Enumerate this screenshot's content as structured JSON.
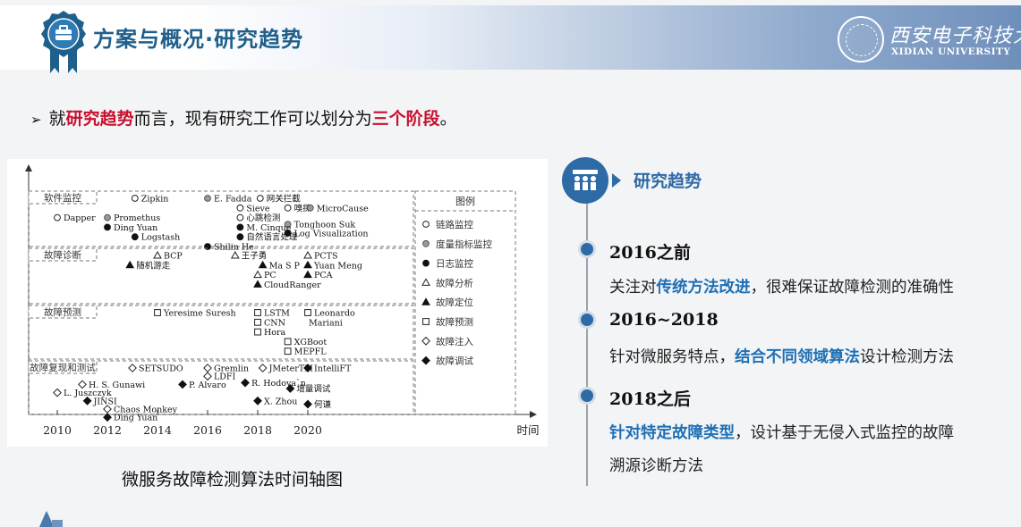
{
  "header": {
    "title": "方案与概况·研究趋势",
    "university_cn": "西安电子科技大学",
    "university_en": "XIDIAN UNIVERSITY",
    "badge_icon": "briefcase-icon"
  },
  "intro": {
    "bullet": "➢",
    "p1": "就",
    "p2": "研究趋势",
    "p3": "而言，现有研究工作可以划分为",
    "p4": "三个阶段",
    "p5": "。"
  },
  "chart_data": {
    "type": "timeline",
    "xlabel": "时间",
    "x_ticks": [
      "2010",
      "2012",
      "2014",
      "2016",
      "2018",
      "2020"
    ],
    "legend_title": "图例",
    "legend": [
      {
        "marker": "circle-open",
        "label": "链路监控"
      },
      {
        "marker": "circle-gray",
        "label": "度量指标监控"
      },
      {
        "marker": "circle-filled",
        "label": "日志监控"
      },
      {
        "marker": "triangle-open",
        "label": "故障分析"
      },
      {
        "marker": "triangle-filled",
        "label": "故障定位"
      },
      {
        "marker": "square-open",
        "label": "故障预测"
      },
      {
        "marker": "diamond-open",
        "label": "故障注入"
      },
      {
        "marker": "diamond-filled",
        "label": "故障调试"
      }
    ],
    "lanes": [
      {
        "label": "软件监控",
        "items": [
          {
            "m": "circle-open",
            "t": "Zipkin",
            "year": 2013.1,
            "row": 0
          },
          {
            "m": "circle-gray",
            "t": "E. Fadda",
            "year": 2016,
            "row": 0
          },
          {
            "m": "circle-open",
            "t": "网关拦截",
            "year": 2018.1,
            "row": 0
          },
          {
            "m": "circle-open",
            "t": "嗅探",
            "year": 2019.2,
            "row": 1
          },
          {
            "m": "circle-gray",
            "t": "MicroCause",
            "year": 2020.1,
            "row": 1
          },
          {
            "m": "circle-open",
            "t": "Dapper",
            "year": 2010,
            "row": 2
          },
          {
            "m": "circle-gray",
            "t": "Promethus",
            "year": 2012,
            "row": 2
          },
          {
            "m": "circle-open",
            "t": "Sieve",
            "year": 2017.3,
            "row": 1
          },
          {
            "m": "circle-open",
            "t": "心跳检测",
            "year": 2017.3,
            "row": 2
          },
          {
            "m": "circle-gray",
            "t": "Tonghoon Suk",
            "year": 2019.2,
            "row": 2.7
          },
          {
            "m": "circle-filled",
            "t": "Ding Yuan",
            "year": 2012,
            "row": 3
          },
          {
            "m": "circle-filled",
            "t": "M. Cinque",
            "year": 2017.3,
            "row": 3
          },
          {
            "m": "circle-filled",
            "t": "Log Visualization",
            "year": 2019.2,
            "row": 3.6
          },
          {
            "m": "circle-filled",
            "t": "Logstash",
            "year": 2013.1,
            "row": 4
          },
          {
            "m": "circle-filled",
            "t": "自然语言处理",
            "year": 2017.3,
            "row": 4
          },
          {
            "m": "circle-filled",
            "t": "Shilin He",
            "year": 2016,
            "row": 5
          }
        ]
      },
      {
        "label": "故障诊断",
        "items": [
          {
            "m": "triangle-open",
            "t": "BCP",
            "year": 2014,
            "row": 0
          },
          {
            "m": "triangle-open",
            "t": "王子勇",
            "year": 2017.1,
            "row": 0
          },
          {
            "m": "triangle-open",
            "t": "PCTS",
            "year": 2020,
            "row": 0
          },
          {
            "m": "triangle-filled",
            "t": "Ma S P",
            "year": 2018.2,
            "row": 1
          },
          {
            "m": "triangle-filled",
            "t": "Yuan Meng",
            "year": 2020,
            "row": 1
          },
          {
            "m": "triangle-filled",
            "t": "随机游走",
            "year": 2012.9,
            "row": 1
          },
          {
            "m": "triangle-open",
            "t": "PC",
            "year": 2018,
            "row": 2
          },
          {
            "m": "triangle-filled",
            "t": "PCA",
            "year": 2020,
            "row": 2
          },
          {
            "m": "triangle-filled",
            "t": "CloudRanger",
            "year": 2018,
            "row": 3
          }
        ]
      },
      {
        "label": "故障预测",
        "items": [
          {
            "m": "square-open",
            "t": "Yeresime Suresh",
            "year": 2014,
            "row": 0
          },
          {
            "m": "square-open",
            "t": "LSTM",
            "year": 2018,
            "row": 0
          },
          {
            "m": "square-open",
            "t": "Leonardo",
            "year": 2020,
            "row": 0
          },
          {
            "m": "square-open",
            "t": "CNN",
            "year": 2018,
            "row": 1
          },
          {
            "m": "square-open",
            "t": "Mariani",
            "year": 2020,
            "row": 1,
            "nomark": true
          },
          {
            "m": "square-open",
            "t": "Hora",
            "year": 2018,
            "row": 2
          },
          {
            "m": "square-open",
            "t": "XGBoot",
            "year": 2019.2,
            "row": 3
          },
          {
            "m": "square-open",
            "t": "MEPFL",
            "year": 2019.2,
            "row": 4
          }
        ]
      },
      {
        "label": "故障复现和测试",
        "items": [
          {
            "m": "diamond-open",
            "t": "SETSUDO",
            "year": 2013,
            "row": 0
          },
          {
            "m": "diamond-open",
            "t": "Gremlin",
            "year": 2016,
            "row": 0
          },
          {
            "m": "diamond-open",
            "t": "JMeterTM",
            "year": 2018.2,
            "row": 0
          },
          {
            "m": "diamond-filled",
            "t": "IntelliFT",
            "year": 2020,
            "row": 0
          },
          {
            "m": "diamond-open",
            "t": "LDFI",
            "year": 2016,
            "row": 1
          },
          {
            "m": "diamond-open",
            "t": "H. S. Gunawi",
            "year": 2011,
            "row": 2
          },
          {
            "m": "diamond-filled",
            "t": "P. Alvaro",
            "year": 2015,
            "row": 2
          },
          {
            "m": "diamond-filled",
            "t": "R. Hodova`n",
            "year": 2017.5,
            "row": 1.8
          },
          {
            "m": "diamond-filled",
            "t": "增量调试",
            "year": 2019.3,
            "row": 2.5
          },
          {
            "m": "diamond-open",
            "t": "L. Juszczyk",
            "year": 2010,
            "row": 3
          },
          {
            "m": "diamond-filled",
            "t": "JINSI",
            "year": 2011.2,
            "row": 4
          },
          {
            "m": "diamond-filled",
            "t": "X. Zhou",
            "year": 2018,
            "row": 4
          },
          {
            "m": "diamond-filled",
            "t": "何谦",
            "year": 2020,
            "row": 4.4
          },
          {
            "m": "diamond-open",
            "t": "Chaos Monkey",
            "year": 2012,
            "row": 5
          },
          {
            "m": "diamond-filled",
            "t": "Ding Yuan",
            "year": 2012,
            "row": 6
          }
        ]
      }
    ]
  },
  "caption": "微服务故障检测算法时间轴图",
  "trend": {
    "title": "研究趋势",
    "icon": "team-icon",
    "stages": [
      {
        "title": "2016之前",
        "d1": "关注对",
        "d2": "传统方法改进",
        "d3": "，很难保证故障检测的准确性"
      },
      {
        "title": "2016~2018",
        "d1": "针对微服务特点，",
        "d2": "结合不同领域算法",
        "d3": "设计检测方法"
      },
      {
        "title": "2018之后",
        "d1": "",
        "d2": "针对特定故障类型",
        "d3": "，设计基于无侵入式监控的故障",
        "d4": "溯源诊断方法"
      }
    ]
  }
}
